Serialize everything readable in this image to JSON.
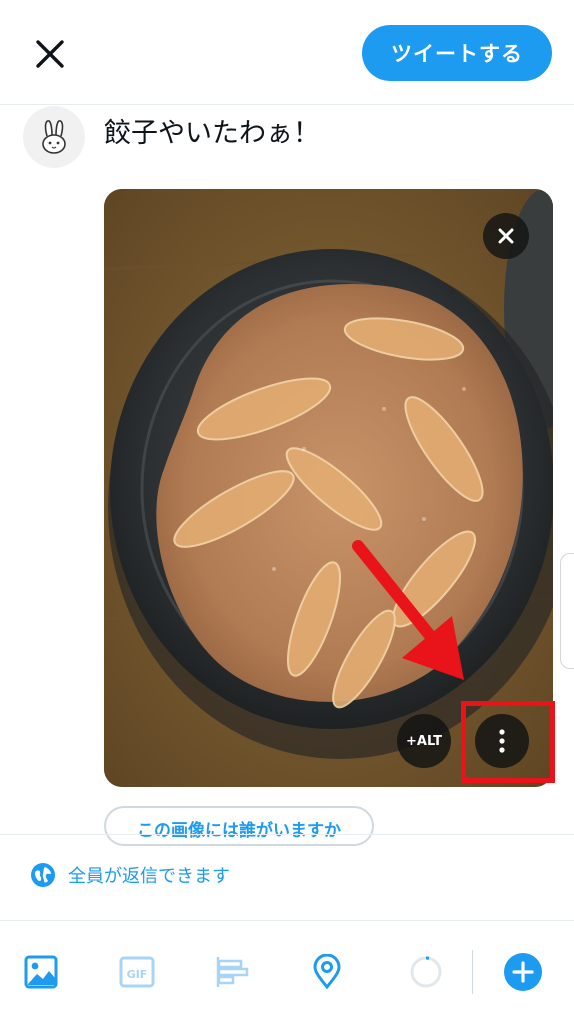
{
  "header": {
    "tweet_button_label": "ツイートする"
  },
  "composer": {
    "text": "餃子やいたわぁ！"
  },
  "media": {
    "alt_button_label": "+ALT"
  },
  "tag_people_label": "この画像には誰がいますか",
  "reply_setting_label": "全員が返信できます",
  "toolbar": {
    "gif_label": "GIF"
  },
  "colors": {
    "accent": "#1d9bf0",
    "highlight": "#e8141a"
  }
}
